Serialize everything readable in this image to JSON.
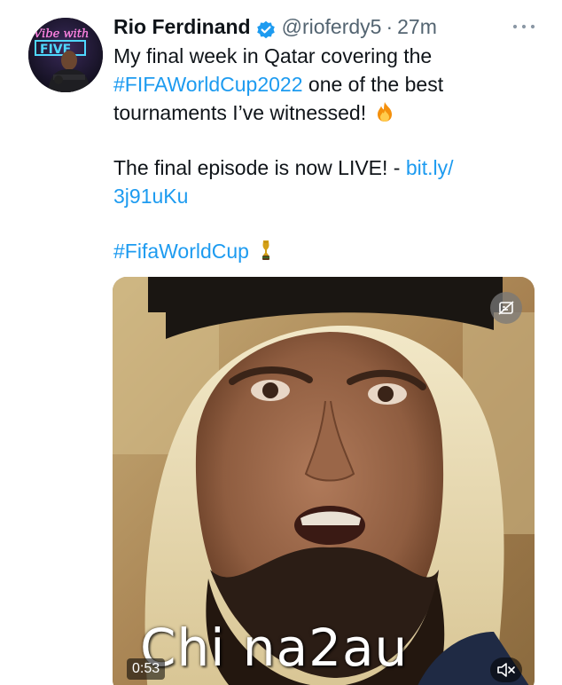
{
  "tweet": {
    "author_name": "Rio Ferdinand",
    "handle": "@rioferdy5",
    "separator": "·",
    "time": "27m",
    "body": {
      "line1": "My final week in Qatar covering the",
      "hashtag1": "#FIFAWorldCup2022",
      "line2_rest": " one of the best",
      "line3": "tournaments I’ve witnessed!",
      "line4": "The final episode is now LIVE! - ",
      "link_part1": "bit.ly/",
      "link_part2": "3j91uKu",
      "hashtag2": "#FifaWorldCup"
    },
    "emoji_fire": "fire-emoji",
    "emoji_trophy": "trophy-emoji"
  },
  "avatar": {
    "neon_text": "Vibe with FIVE",
    "icon": "profile-avatar"
  },
  "media": {
    "video_time": "0:53",
    "alt_icon": "no-captions-icon",
    "mute_icon": "speaker-muted-icon"
  },
  "watermark": {
    "text": "Chi na2au"
  },
  "colors": {
    "link": "#1d9bf0",
    "verified": "#1d9bf0",
    "secondary_text": "#536471"
  }
}
